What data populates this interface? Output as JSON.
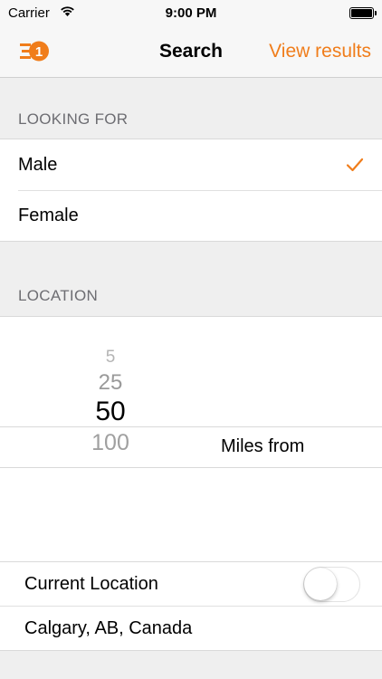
{
  "status_bar": {
    "carrier": "Carrier",
    "time": "9:00 PM"
  },
  "nav": {
    "logo_badge": "1",
    "title": "Search",
    "action": "View results"
  },
  "looking_for": {
    "header": "LOOKING FOR",
    "options": [
      {
        "label": "Male",
        "selected": true
      },
      {
        "label": "Female",
        "selected": false
      }
    ]
  },
  "location": {
    "header": "LOCATION",
    "distances": [
      "5",
      "25",
      "50",
      "100"
    ],
    "selected_distance": "50",
    "units_label": "Miles from",
    "current_location_label": "Current Location",
    "current_location_enabled": false,
    "place": "Calgary, AB, Canada"
  },
  "colors": {
    "accent": "#f07d1b",
    "background": "#efefef"
  }
}
